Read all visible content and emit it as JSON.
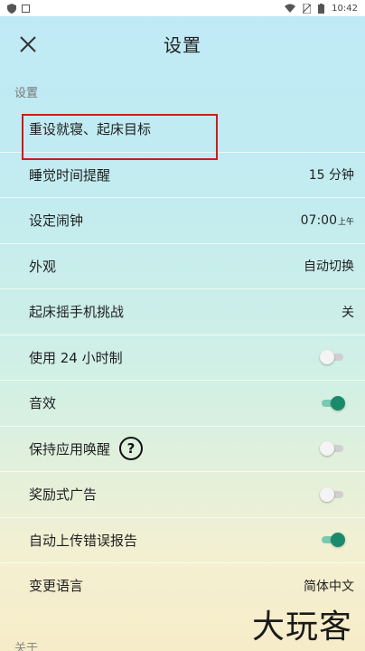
{
  "status_bar": {
    "time": "10:42",
    "left_icons": [
      "shield-icon",
      "square-icon"
    ],
    "right_icons": [
      "wifi-icon",
      "no-sim-icon",
      "battery-icon"
    ]
  },
  "header": {
    "title": "设置",
    "close_icon": "close-icon"
  },
  "section_title": "设置",
  "settings": {
    "reset_goals": {
      "label": "重设就寝、起床目标"
    },
    "sleep_reminder": {
      "label": "睡觉时间提醒",
      "value": "15 分钟"
    },
    "alarm": {
      "label": "设定闹钟",
      "value": "07:00",
      "suffix": "上午"
    },
    "appearance": {
      "label": "外观",
      "value": "自动切换"
    },
    "shake_challenge": {
      "label": "起床摇手机挑战",
      "value": "关"
    },
    "format_24h": {
      "label": "使用 24 小时制",
      "toggle": false
    },
    "sound": {
      "label": "音效",
      "toggle": true
    },
    "keep_awake": {
      "label": "保持应用唤醒",
      "toggle": false,
      "help_icon": "?"
    },
    "reward_ads": {
      "label": "奖励式广告",
      "toggle": false
    },
    "upload_reports": {
      "label": "自动上传错误报告",
      "toggle": true
    },
    "language": {
      "label": "变更语言",
      "value": "简体中文"
    }
  },
  "next_section_title": "关于",
  "watermark": "大玩客",
  "colors": {
    "toggle_on": "#1b8a6b",
    "toggle_off": "#cfcfcf",
    "highlight": "#d01a1a"
  }
}
